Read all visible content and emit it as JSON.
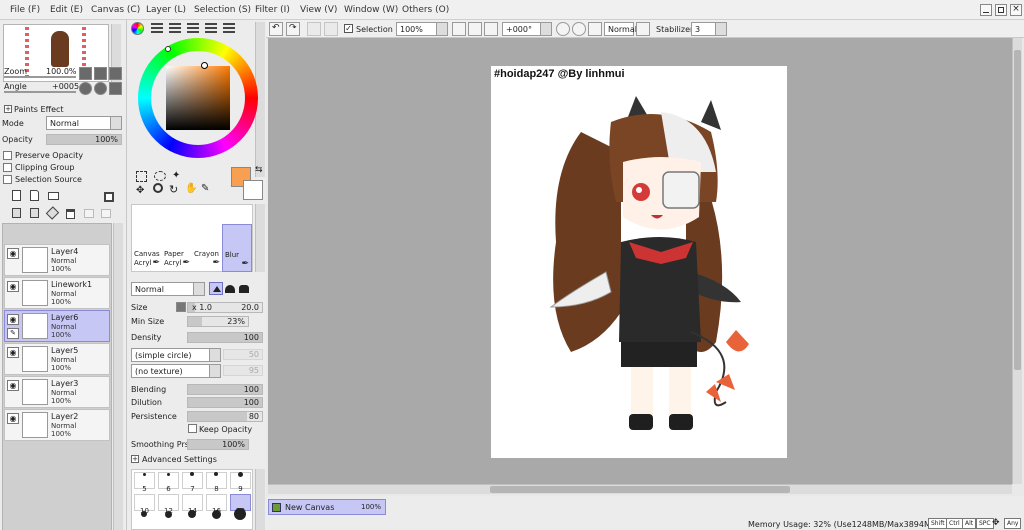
{
  "menu": [
    "File (F)",
    "Edit (E)",
    "Canvas (C)",
    "Layer (L)",
    "Selection (S)",
    "Filter (I)",
    "View (V)",
    "Window (W)",
    "Others (O)"
  ],
  "navigator": {
    "zoom_label": "Zoom",
    "zoom_value": "100.0%",
    "angle_label": "Angle",
    "angle_value": "+0005"
  },
  "paints_effect": {
    "title": "Paints Effect",
    "mode_label": "Mode",
    "mode_value": "Normal",
    "opacity_label": "Opacity",
    "opacity_value": "100%",
    "opacity_level": 1.0
  },
  "options": {
    "preserve_opacity": "Preserve Opacity",
    "clipping_group": "Clipping Group",
    "selection_source": "Selection Source"
  },
  "layers": [
    {
      "name": "Layer4",
      "mode": "Normal",
      "opacity": "100%",
      "selected": false,
      "linework": false
    },
    {
      "name": "Linework1",
      "mode": "Normal",
      "opacity": "100%",
      "selected": false,
      "linework": true
    },
    {
      "name": "Layer6",
      "mode": "Normal",
      "opacity": "100%",
      "selected": true,
      "linework": false
    },
    {
      "name": "Layer5",
      "mode": "Normal",
      "opacity": "100%",
      "selected": false,
      "linework": false
    },
    {
      "name": "Layer3",
      "mode": "Normal",
      "opacity": "100%",
      "selected": false,
      "linework": false
    },
    {
      "name": "Layer2",
      "mode": "Normal",
      "opacity": "100%",
      "selected": false,
      "linework": false
    }
  ],
  "colors": {
    "primary": "#f7a052",
    "secondary": "#ffffff",
    "accent": "#c7c7f5"
  },
  "tools": [
    {
      "line1": "Canvas",
      "line2": "Acryl"
    },
    {
      "line1": "Paper",
      "line2": "Acryl"
    },
    {
      "line1": "Crayon",
      "line2": ""
    },
    {
      "line1": "Blur",
      "line2": ""
    }
  ],
  "brush": {
    "blend_mode": "Normal",
    "size_label": "Size",
    "size_mult": "x 1.0",
    "size_value": "20.0",
    "min_size_label": "Min Size",
    "min_size_value": "23%",
    "min_size_level": 0.23,
    "density_label": "Density",
    "density_value": "100",
    "density_level": 1.0,
    "shape": "(simple circle)",
    "shape_value": "50",
    "texture": "(no texture)",
    "texture_value": "95",
    "blending_label": "Blending",
    "blending_value": "100",
    "blending_level": 1.0,
    "dilution_label": "Dilution",
    "dilution_value": "100",
    "dilution_level": 1.0,
    "persistence_label": "Persistence",
    "persistence_value": "80",
    "persistence_level": 0.8,
    "keep_opacity": "Keep Opacity",
    "smoothing_label": "Smoothing Prs",
    "smoothing_value": "100%",
    "smoothing_level": 1.0,
    "advanced": "Advanced Settings",
    "sizes_row1": [
      "5",
      "6",
      "7",
      "8",
      "9"
    ],
    "sizes_row2": [
      "10",
      "12",
      "14",
      "16",
      "20"
    ]
  },
  "toolbar": {
    "selection_label": "Selection",
    "zoom_value": "100%",
    "angle_value": "+000°",
    "blend_value": "Normal",
    "stabilizer_label": "Stabilizer",
    "stabilizer_value": "3"
  },
  "canvas": {
    "watermark": "#hoidap247 @By linhmui"
  },
  "canvas_tab": {
    "name": "New Canvas",
    "zoom": "100%"
  },
  "status": {
    "memory": "Memory Usage: 32% (Use1248MB/Max3894MB)",
    "keys": [
      "Shift",
      "Ctrl",
      "Alt",
      "SPC",
      "Any"
    ]
  }
}
